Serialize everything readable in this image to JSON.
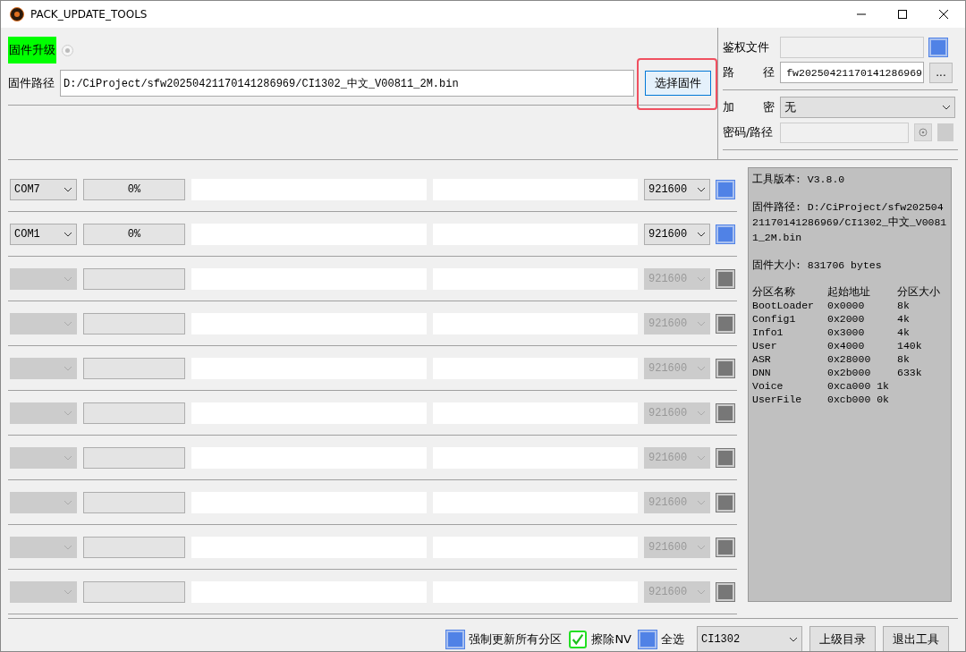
{
  "window": {
    "title": "PACK_UPDATE_TOOLS"
  },
  "upgrade": {
    "label": "固件升级",
    "radio_selected": true
  },
  "firmware_path": {
    "label": "固件路径",
    "value": "D:/CiProject/sfw20250421170141286969/CI1302_中文_V00811_2M.bin"
  },
  "select_button": {
    "label": "选择固件",
    "highlighted": true
  },
  "auth": {
    "label": "鉴权文件",
    "checked": false
  },
  "path": {
    "label": "路径",
    "value": "fw20250421170141286969",
    "browse": "..."
  },
  "encrypt": {
    "label": "加密",
    "value": "无"
  },
  "password": {
    "label": "密码/路径",
    "option_enabled": false
  },
  "ports": [
    {
      "port": "COM7",
      "progress": "0%",
      "baud": "921600",
      "enabled": true,
      "checked": false
    },
    {
      "port": "COM1",
      "progress": "0%",
      "baud": "921600",
      "enabled": true,
      "checked": false
    },
    {
      "baud": "921600",
      "enabled": false,
      "checked": false
    },
    {
      "baud": "921600",
      "enabled": false,
      "checked": false
    },
    {
      "baud": "921600",
      "enabled": false,
      "checked": false
    },
    {
      "baud": "921600",
      "enabled": false,
      "checked": false
    },
    {
      "baud": "921600",
      "enabled": false,
      "checked": false
    },
    {
      "baud": "921600",
      "enabled": false,
      "checked": false
    },
    {
      "baud": "921600",
      "enabled": false,
      "checked": false
    },
    {
      "baud": "921600",
      "enabled": false,
      "checked": false
    }
  ],
  "info": {
    "lines": [
      "工具版本: V3.8.0",
      "固件路径: D:/CiProject/sfw20250421170141286969/CI1302_中文_V00811_2M.bin",
      "固件大小: 831706 bytes"
    ],
    "table": [
      [
        "分区名称",
        "起始地址",
        "分区大小"
      ],
      [
        "BootLoader",
        "0x0000",
        "8k"
      ],
      [
        "Config1",
        "0x2000",
        "4k"
      ],
      [
        "Info1",
        "0x3000",
        "4k"
      ],
      [
        "User",
        "0x4000",
        "140k"
      ],
      [
        "ASR",
        "0x28000",
        "8k"
      ],
      [
        "DNN",
        "0x2b000",
        "633k"
      ],
      [
        "Voice",
        "0xca000 1k"
      ],
      [
        "UserFile",
        "0xcb000 0k"
      ]
    ]
  },
  "bottom": {
    "options": [
      {
        "label": "强制更新所有分区",
        "checked": false
      },
      {
        "label": "擦除NV",
        "checked": true
      },
      {
        "label": "全选",
        "checked": false
      }
    ],
    "chip": "CI1302",
    "buttons": [
      "上级目录",
      "退出工具"
    ]
  }
}
